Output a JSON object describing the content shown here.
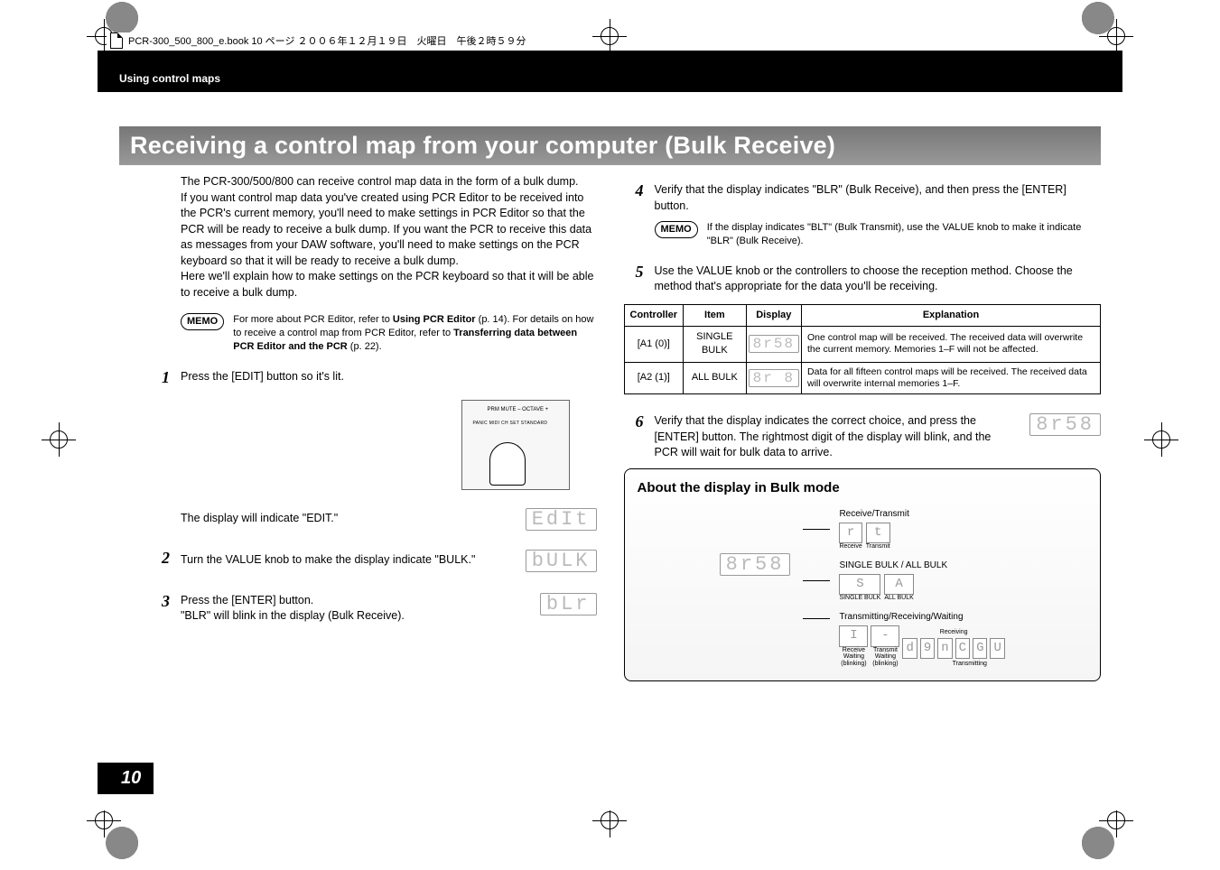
{
  "header": {
    "filename": "PCR-300_500_800_e.book  10 ページ  ２００６年１２月１９日　火曜日　午後２時５９分"
  },
  "section_header": "Using control maps",
  "page_number": "10",
  "title": "Receiving a control map from your computer (Bulk Receive)",
  "intro": [
    "The PCR-300/500/800 can receive control map data in the form of a bulk dump.",
    "If you want control map data you've created using PCR Editor to be received into the PCR's current memory, you'll need to make settings in PCR Editor so that the PCR will be ready to receive a bulk dump. If you want the PCR to receive this data as messages from your DAW software, you'll need to make settings on the PCR keyboard so that it will be ready to receive a bulk dump.",
    "Here we'll explain how to make settings on the PCR keyboard so that it will be able to receive a bulk dump."
  ],
  "memo1": {
    "label": "MEMO",
    "text_parts": [
      "For more about PCR Editor, refer to ",
      "Using PCR Editor",
      " (p. 14). For details on how to receive a control map from PCR Editor, refer to ",
      "Transferring data between PCR Editor and the PCR",
      " (p. 22)."
    ]
  },
  "steps_left": {
    "s1": {
      "num": "1",
      "text": "Press the [EDIT] button so it's lit."
    },
    "fig_labels": {
      "l1": "PRM MUTE      –   OCTAVE   +",
      "l2": "PANIC        MIDI CH SET     STANDARD"
    },
    "s1b": {
      "text": "The display will indicate \"EDIT.\"",
      "disp": "EdIt"
    },
    "s2": {
      "num": "2",
      "text": "Turn the VALUE knob to make the display indicate \"BULK.\"",
      "disp": "bULK"
    },
    "s3": {
      "num": "3",
      "text1": "Press the [ENTER] button.",
      "text2": "\"BLR\" will blink in the display (Bulk Receive).",
      "disp": " bLr"
    }
  },
  "steps_right": {
    "s4": {
      "num": "4",
      "text": "Verify that the display indicates \"BLR\" (Bulk Receive), and then press the [ENTER] button."
    },
    "memo2": {
      "label": "MEMO",
      "text": "If the display indicates \"BLT\" (Bulk Transmit), use the VALUE knob to make it indicate \"BLR\" (Bulk Receive)."
    },
    "s5": {
      "num": "5",
      "text": "Use the VALUE knob or the controllers to choose the reception method. Choose the method that's appropriate for the data you'll be receiving."
    },
    "table": {
      "headers": [
        "Controller",
        "Item",
        "Display",
        "Explanation"
      ],
      "rows": [
        {
          "controller": "[A1 (0)]",
          "item": "SINGLE BULK",
          "disp": "8r58",
          "expl": "One control map will be received. The received data will overwrite the current memory.\nMemories 1–F will not be affected."
        },
        {
          "controller": "[A2 (1)]",
          "item": "ALL BULK",
          "disp": "8r 8",
          "expl": "Data for all fifteen control maps will be received. The received data will overwrite internal memories 1–F."
        }
      ]
    },
    "s6": {
      "num": "6",
      "text": "Verify that the display indicates the correct choice, and press the [ENTER] button. The rightmost digit of the display will blink, and the PCR will wait for bulk data to arrive.",
      "disp": "8r58"
    }
  },
  "about": {
    "title": "About the display in Bulk mode",
    "main_disp": "8r58",
    "rows": {
      "r1": {
        "label": "Receive/Transmit",
        "cells": [
          "r",
          "t"
        ],
        "sub": [
          "Receive",
          "Transmit"
        ]
      },
      "r2": {
        "label": "SINGLE BULK / ALL BULK",
        "cells": [
          "S",
          "A"
        ],
        "sub": [
          "SINGLE BULK",
          "ALL BULK"
        ]
      },
      "r3": {
        "label": "Transmitting/Receiving/Waiting",
        "cells": [
          "I",
          "-",
          "d",
          "9",
          "n",
          "C",
          "G",
          "U"
        ],
        "sub_left": [
          "Receive Waiting (blinking)",
          "Transmit Waiting (blinking)"
        ],
        "sub_right1": "Receiving",
        "sub_right2": "Transmitting"
      }
    }
  }
}
